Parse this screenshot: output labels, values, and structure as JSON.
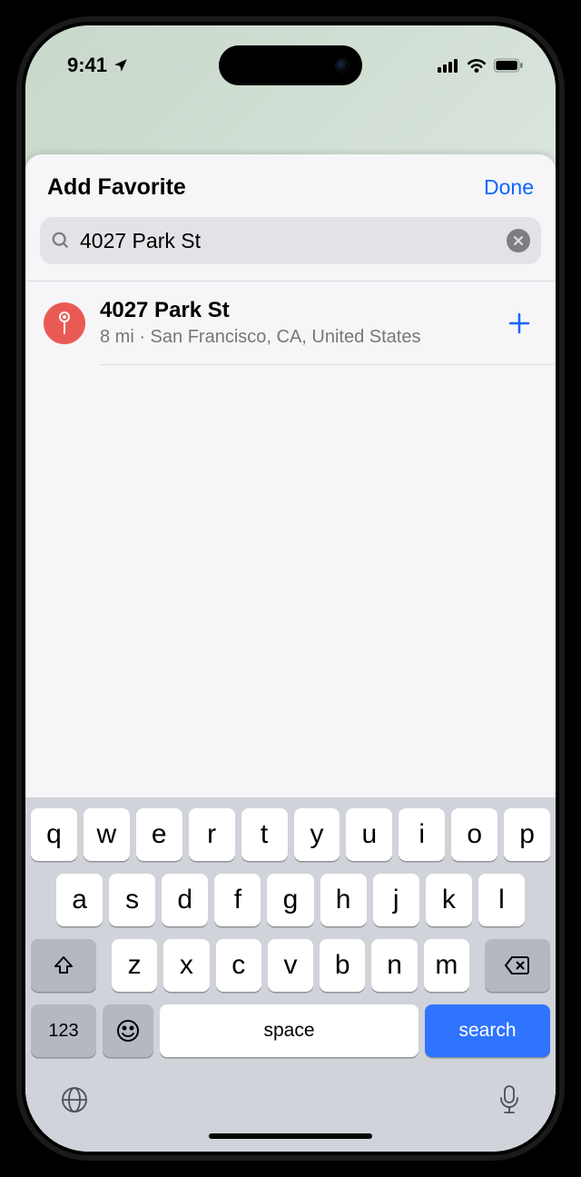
{
  "status": {
    "time": "9:41"
  },
  "sheet": {
    "title": "Add Favorite",
    "done": "Done"
  },
  "search": {
    "value": "4027 Park St"
  },
  "result": {
    "title": "4027 Park St",
    "subtitle": "8 mi · San Francisco, CA, United States"
  },
  "keyboard": {
    "row1": [
      "q",
      "w",
      "e",
      "r",
      "t",
      "y",
      "u",
      "i",
      "o",
      "p"
    ],
    "row2": [
      "a",
      "s",
      "d",
      "f",
      "g",
      "h",
      "j",
      "k",
      "l"
    ],
    "row3": [
      "z",
      "x",
      "c",
      "v",
      "b",
      "n",
      "m"
    ],
    "numKey": "123",
    "space": "space",
    "search": "search"
  }
}
